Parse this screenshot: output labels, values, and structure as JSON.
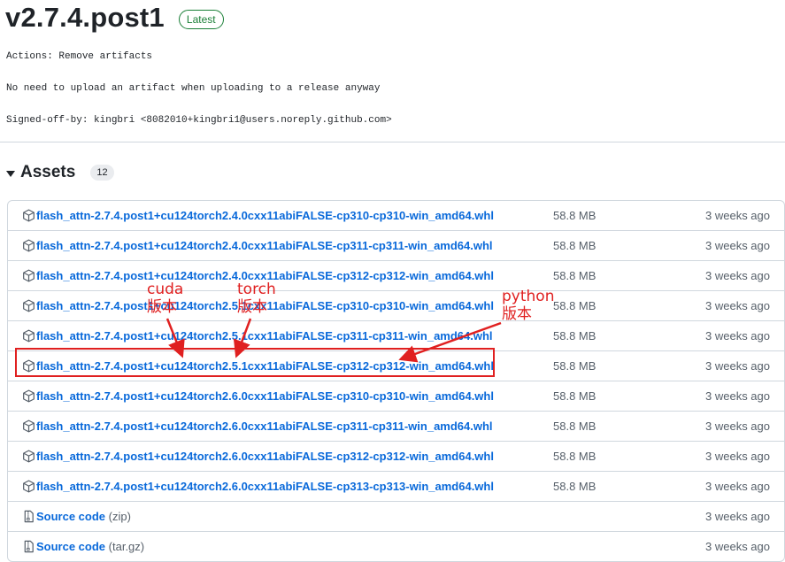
{
  "release": {
    "title": "v2.7.4.post1",
    "badge": "Latest",
    "notes": [
      "Actions: Remove artifacts",
      "No need to upload an artifact when uploading to a release anyway",
      "Signed-off-by: kingbri <8082010+kingbri1@users.noreply.github.com>"
    ]
  },
  "assets": {
    "title": "Assets",
    "count": "12",
    "items": [
      {
        "name": "flash_attn-2.7.4.post1+cu124torch2.4.0cxx11abiFALSE-cp310-cp310-win_amd64.whl",
        "size": "58.8 MB",
        "date": "3 weeks ago"
      },
      {
        "name": "flash_attn-2.7.4.post1+cu124torch2.4.0cxx11abiFALSE-cp311-cp311-win_amd64.whl",
        "size": "58.8 MB",
        "date": "3 weeks ago"
      },
      {
        "name": "flash_attn-2.7.4.post1+cu124torch2.4.0cxx11abiFALSE-cp312-cp312-win_amd64.whl",
        "size": "58.8 MB",
        "date": "3 weeks ago"
      },
      {
        "name": "flash_attn-2.7.4.post1+cu124torch2.5.1cxx11abiFALSE-cp310-cp310-win_amd64.whl",
        "size": "58.8 MB",
        "date": "3 weeks ago"
      },
      {
        "name": "flash_attn-2.7.4.post1+cu124torch2.5.1cxx11abiFALSE-cp311-cp311-win_amd64.whl",
        "size": "58.8 MB",
        "date": "3 weeks ago"
      },
      {
        "name": "flash_attn-2.7.4.post1+cu124torch2.5.1cxx11abiFALSE-cp312-cp312-win_amd64.whl",
        "size": "58.8 MB",
        "date": "3 weeks ago"
      },
      {
        "name": "flash_attn-2.7.4.post1+cu124torch2.6.0cxx11abiFALSE-cp310-cp310-win_amd64.whl",
        "size": "58.8 MB",
        "date": "3 weeks ago"
      },
      {
        "name": "flash_attn-2.7.4.post1+cu124torch2.6.0cxx11abiFALSE-cp311-cp311-win_amd64.whl",
        "size": "58.8 MB",
        "date": "3 weeks ago"
      },
      {
        "name": "flash_attn-2.7.4.post1+cu124torch2.6.0cxx11abiFALSE-cp312-cp312-win_amd64.whl",
        "size": "58.8 MB",
        "date": "3 weeks ago"
      },
      {
        "name": "flash_attn-2.7.4.post1+cu124torch2.6.0cxx11abiFALSE-cp313-cp313-win_amd64.whl",
        "size": "58.8 MB",
        "date": "3 weeks ago"
      }
    ],
    "source": [
      {
        "name": "Source code",
        "ext": "(zip)",
        "date": "3 weeks ago"
      },
      {
        "name": "Source code",
        "ext": "(tar.gz)",
        "date": "3 weeks ago"
      }
    ]
  },
  "annotations": {
    "cuda": "cuda",
    "cuda_sub": "版本",
    "torch": "torch",
    "torch_sub": "版本",
    "python": "python",
    "python_sub": "版本",
    "color": "#e02020"
  }
}
